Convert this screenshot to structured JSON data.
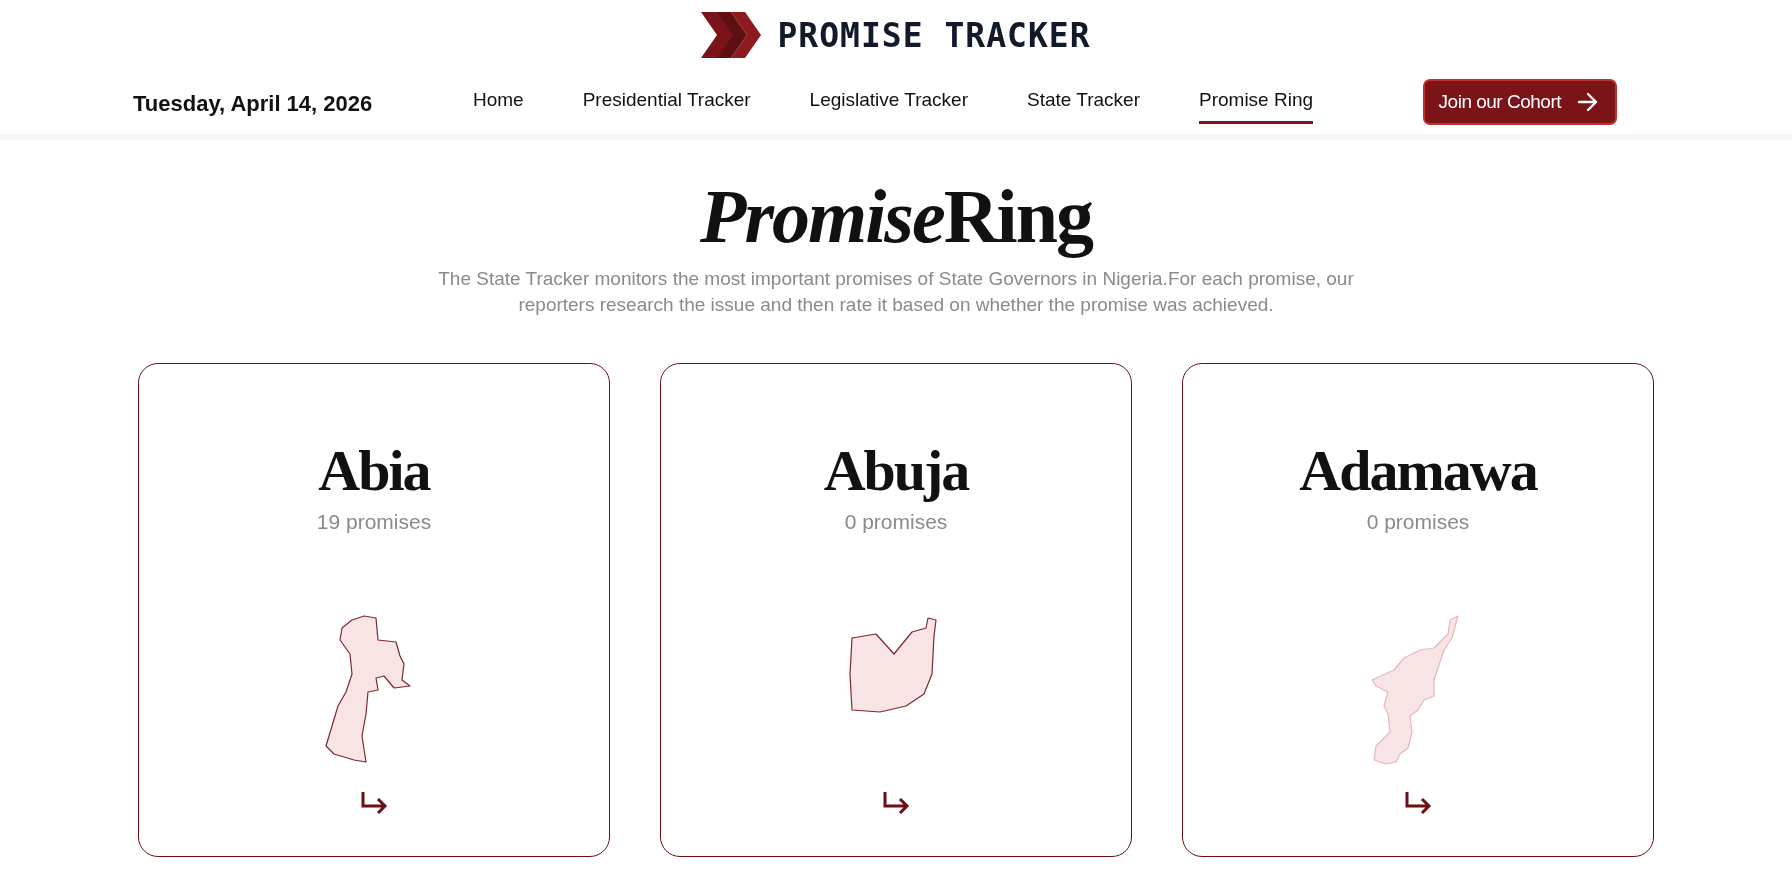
{
  "logo": {
    "text": "PROMISE TRACKER"
  },
  "date": "Tuesday, April 14, 2026",
  "nav": [
    {
      "label": "Home",
      "selected": false
    },
    {
      "label": "Presidential Tracker",
      "selected": false
    },
    {
      "label": "Legislative Tracker",
      "selected": false
    },
    {
      "label": "State Tracker",
      "selected": false
    },
    {
      "label": "Promise Ring",
      "selected": true
    }
  ],
  "cta": {
    "label": "Join our Cohort"
  },
  "heading": {
    "italic_part": "Promise",
    "plain_part": "Ring"
  },
  "intro": "The State Tracker monitors the most important promises of State Governors in Nigeria.For each promise, our reporters research the issue and then rate it based on whether the promise was achieved.",
  "states": [
    {
      "name": "Abia",
      "count": "19 promises"
    },
    {
      "name": "Abuja",
      "count": "0 promises"
    },
    {
      "name": "Adamawa",
      "count": "0 promises"
    }
  ]
}
